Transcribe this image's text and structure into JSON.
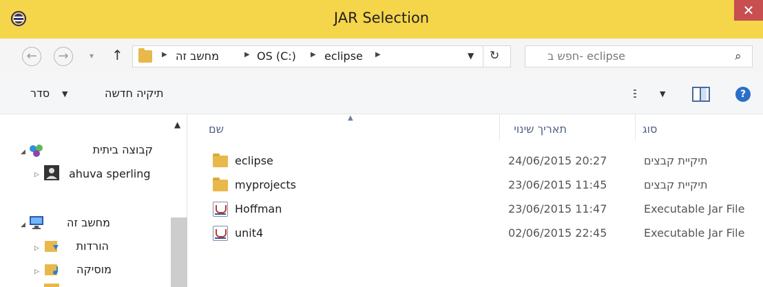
{
  "window": {
    "title": "JAR Selection",
    "close_label": "✕"
  },
  "nav": {
    "back": "←",
    "forward": "→",
    "recent": "▾",
    "up": "↑",
    "breadcrumb": [
      "מחשב זה",
      "OS (C:)",
      "eclipse"
    ],
    "search_placeholder": "חפש ב- eclipse"
  },
  "commands": {
    "organize": "סדר",
    "new_folder": "תיקיה חדשה"
  },
  "sidebar": {
    "items": [
      {
        "label": "קבוצה ביתית",
        "icon": "homegroup-icon"
      },
      {
        "label": "ahuva sperling",
        "icon": "user-icon"
      },
      {
        "label": "מחשב זה",
        "icon": "computer-icon"
      },
      {
        "label": "הורדות",
        "icon": "downloads-folder-icon"
      },
      {
        "label": "מוסיקה",
        "icon": "music-folder-icon"
      }
    ]
  },
  "columns": {
    "name": "שם",
    "date": "תאריך שינוי",
    "type": "סוג"
  },
  "files": [
    {
      "name": "eclipse",
      "date": "24/06/2015 20:27",
      "type": "תיקיית קבצים",
      "icon": "folder-icon"
    },
    {
      "name": "myprojects",
      "date": "23/06/2015 11:45",
      "type": "תיקיית קבצים",
      "icon": "folder-icon"
    },
    {
      "name": "Hoffman",
      "date": "23/06/2015 11:47",
      "type": "Executable Jar File",
      "icon": "jar-file-icon"
    },
    {
      "name": "unit4",
      "date": "02/06/2015 22:45",
      "type": "Executable Jar File",
      "icon": "jar-file-icon"
    }
  ],
  "colors": {
    "titlebar": "#f5d54a",
    "close": "#c74f4f",
    "accent": "#4d6082"
  }
}
